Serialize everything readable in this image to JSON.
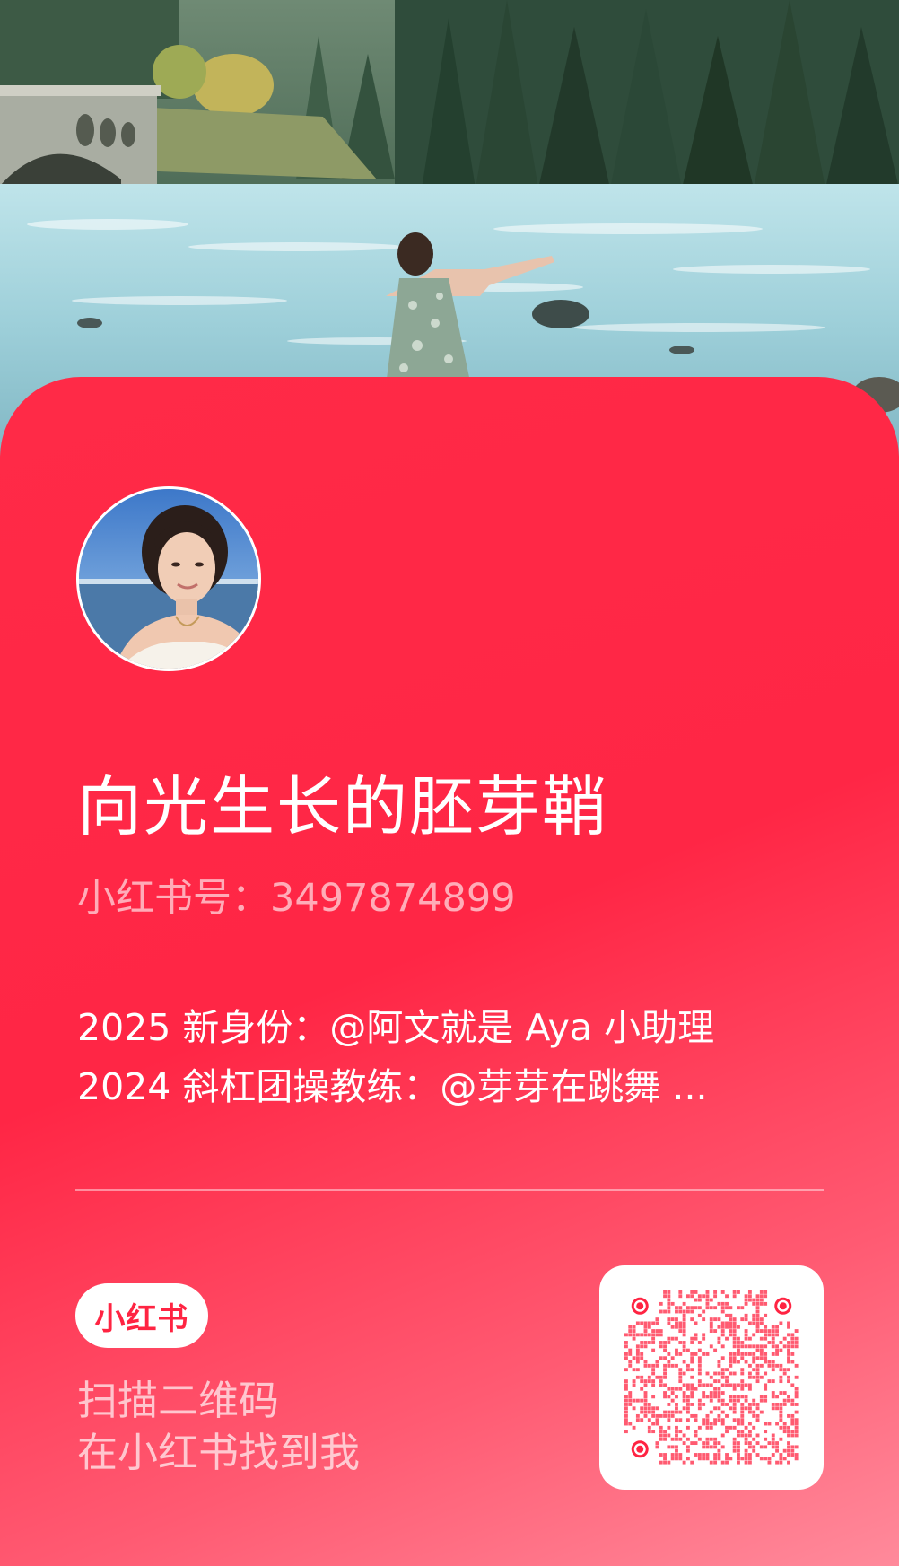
{
  "profile": {
    "name": "向光生长的胚芽鞘",
    "red_id": "小红书号：3497874899",
    "bio": [
      "2025 新身份：@阿文就是 Aya 小助理",
      "2024 斜杠团操教练：@芽芽在跳舞 ..."
    ]
  },
  "footer": {
    "logo_text": "小红书",
    "scan_lines": [
      "扫描二维码",
      "在小红书找到我"
    ]
  },
  "icons": {
    "logo": "xiaohongshu-logo",
    "qr": "qr-code"
  },
  "colors": {
    "card_red": "#ff2442",
    "card_pink": "#ff8a9b",
    "white": "#ffffff"
  }
}
